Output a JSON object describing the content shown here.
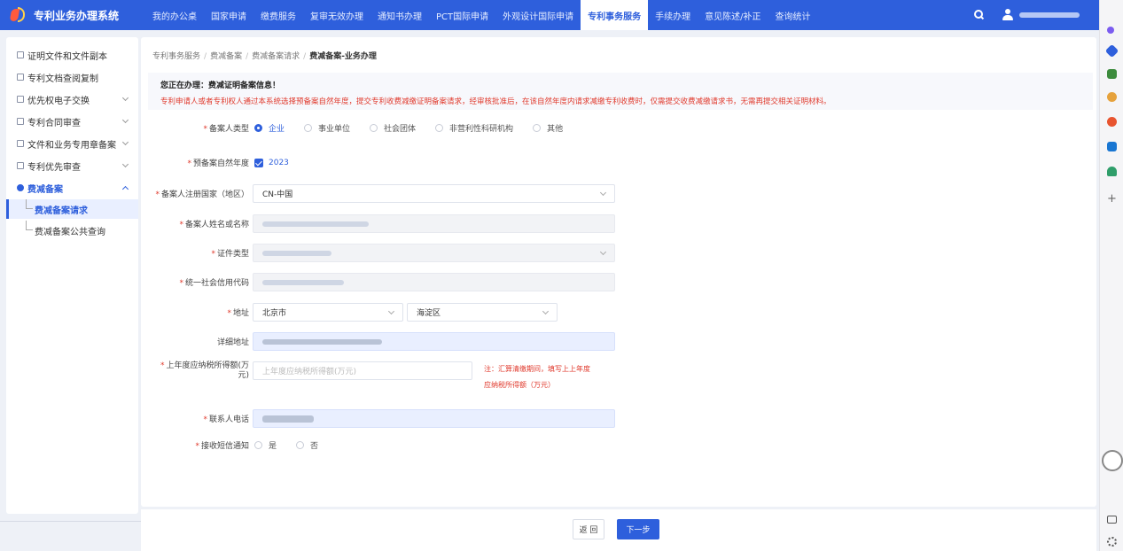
{
  "app": {
    "title": "专利业务办理系统"
  },
  "nav": {
    "items": [
      {
        "label": "我的办公桌",
        "active": false
      },
      {
        "label": "国家申请",
        "active": false
      },
      {
        "label": "缴费服务",
        "active": false
      },
      {
        "label": "复审无效办理",
        "active": false
      },
      {
        "label": "通知书办理",
        "active": false
      },
      {
        "label": "PCT国际申请",
        "active": false
      },
      {
        "label": "外观设计国际申请",
        "active": false
      },
      {
        "label": "专利事务服务",
        "active": true
      },
      {
        "label": "手续办理",
        "active": false
      },
      {
        "label": "意见陈述/补正",
        "active": false
      },
      {
        "label": "查询统计",
        "active": false
      }
    ],
    "search_icon": "search-icon",
    "user_icon": "user-icon"
  },
  "sidebar": {
    "items": [
      {
        "label": "证明文件和文件副本",
        "icon": "certificate-icon",
        "expandable": false
      },
      {
        "label": "专利文档查阅复制",
        "icon": "document-icon",
        "expandable": false
      },
      {
        "label": "优先权电子交换",
        "icon": "exchange-icon",
        "expandable": true
      },
      {
        "label": "专利合同审查",
        "icon": "contract-icon",
        "expandable": true
      },
      {
        "label": "文件和业务专用章备案",
        "icon": "seal-icon",
        "expandable": true
      },
      {
        "label": "专利优先审查",
        "icon": "priority-icon",
        "expandable": true
      }
    ],
    "open_group": {
      "label": "费减备案",
      "icon": "fee-reduction-icon",
      "children": [
        {
          "label": "费减备案请求",
          "active": true
        },
        {
          "label": "费减备案公共查询",
          "active": false
        }
      ]
    }
  },
  "breadcrumb": [
    "专利事务服务",
    "费减备案",
    "费减备案请求",
    "费减备案-业务办理"
  ],
  "notice": {
    "title": "您正在办理：费减证明备案信息！",
    "text": "专利申请人或者专利权人通过本系统选择预备案自然年度，提交专利收费减缴证明备案请求，经审核批准后，在该自然年度内请求减缴专利收费时，仅需提交收费减缴请求书，无需再提交相关证明材料。"
  },
  "form": {
    "filer_type": {
      "label": "备案人类型",
      "options": [
        "企业",
        "事业单位",
        "社会团体",
        "非营利性科研机构",
        "其他"
      ],
      "selected": "企业"
    },
    "year": {
      "label": "预备案自然年度",
      "value": "2023",
      "checked": true
    },
    "country": {
      "label": "备案人注册国家（地区）",
      "value": "CN-中国"
    },
    "name": {
      "label": "备案人姓名或名称"
    },
    "cert_type": {
      "label": "证件类型"
    },
    "credit_code": {
      "label": "统一社会信用代码"
    },
    "address": {
      "label": "地址",
      "province": "北京市",
      "district": "海淀区"
    },
    "detail_address": {
      "label": "详细地址"
    },
    "income": {
      "label_line1": "上年度应纳税所得额(万",
      "label_line2": "元)",
      "placeholder": "上年度应纳税所得额(万元)",
      "hint_line1": "注：汇算清缴期间，填写上上年度",
      "hint_line2": "应纳税所得额（万元）"
    },
    "phone": {
      "label": "联系人电话"
    },
    "sms": {
      "label": "接收短信通知",
      "options": [
        "是",
        "否"
      ]
    }
  },
  "footer": {
    "back_label": "返 回",
    "next_label": "下一步"
  },
  "colors": {
    "primary": "#2e5fdc",
    "warning": "#e03a2d",
    "filled_bg": "#e9efff"
  }
}
